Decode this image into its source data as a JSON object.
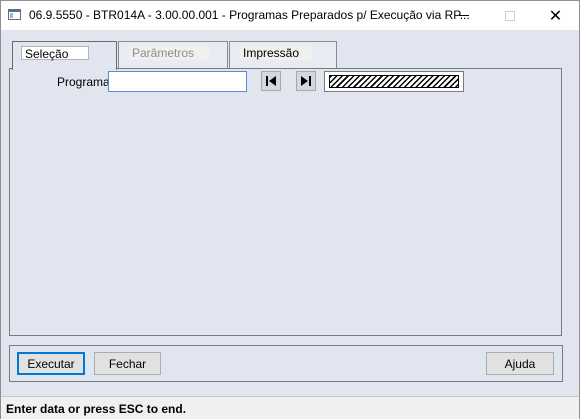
{
  "window": {
    "title": "06.9.5550 - BTR014A - 3.00.00.001 - Programas Preparados p/ Execução via RP...",
    "controls": {
      "minimize": "minimize",
      "maximize": "maximize",
      "close": "✕"
    }
  },
  "tabs": [
    {
      "label": "Seleção",
      "selected": true,
      "enabled": true
    },
    {
      "label": "Parâmetros",
      "selected": false,
      "enabled": false
    },
    {
      "label": "Impressão",
      "selected": false,
      "enabled": true
    }
  ],
  "form": {
    "programa_label": "Programa:",
    "programa_value": "",
    "nav_first_icon": "skip-to-first-icon",
    "nav_last_icon": "skip-to-last-icon"
  },
  "buttons": {
    "executar": "Executar",
    "fechar": "Fechar",
    "ajuda": "Ajuda"
  },
  "status": {
    "text": "Enter data or press ESC to end."
  },
  "colors": {
    "background": "#e1e5ef",
    "focus_border": "#0078d7"
  }
}
